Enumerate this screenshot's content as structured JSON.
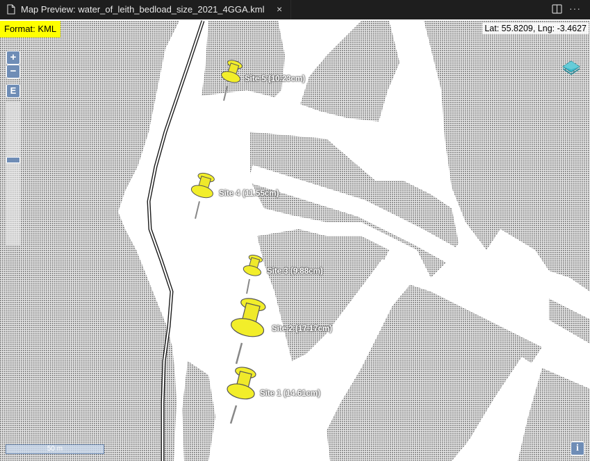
{
  "tab": {
    "title": "Map Preview: water_of_leith_bedload_size_2021_4GGA.kml",
    "close_glyph": "×",
    "doc_icon": "document-icon",
    "split_icon": "split-editor-icon",
    "more_glyph": "···"
  },
  "map": {
    "format_label": "Format: KML",
    "coordinates": "Lat: 55.8209, Lng: -3.4627",
    "zoom_in_label": "+",
    "zoom_out_label": "−",
    "extent_label": "E",
    "scale_label": "50 m",
    "info_label": "i",
    "layers_icon": "layers-icon",
    "badge_color": "#ffff00",
    "control_color": "#6f8db6",
    "pin_color": "#f2ee2a"
  },
  "sites": [
    {
      "label": "Site 5 (10.23cm)"
    },
    {
      "label": "Site 4 (11.55cm)"
    },
    {
      "label": "Site 3 (9.88cm)"
    },
    {
      "label": "Site 2 (17.17cm)"
    },
    {
      "label": "Site 1 (14.61cm)"
    }
  ]
}
